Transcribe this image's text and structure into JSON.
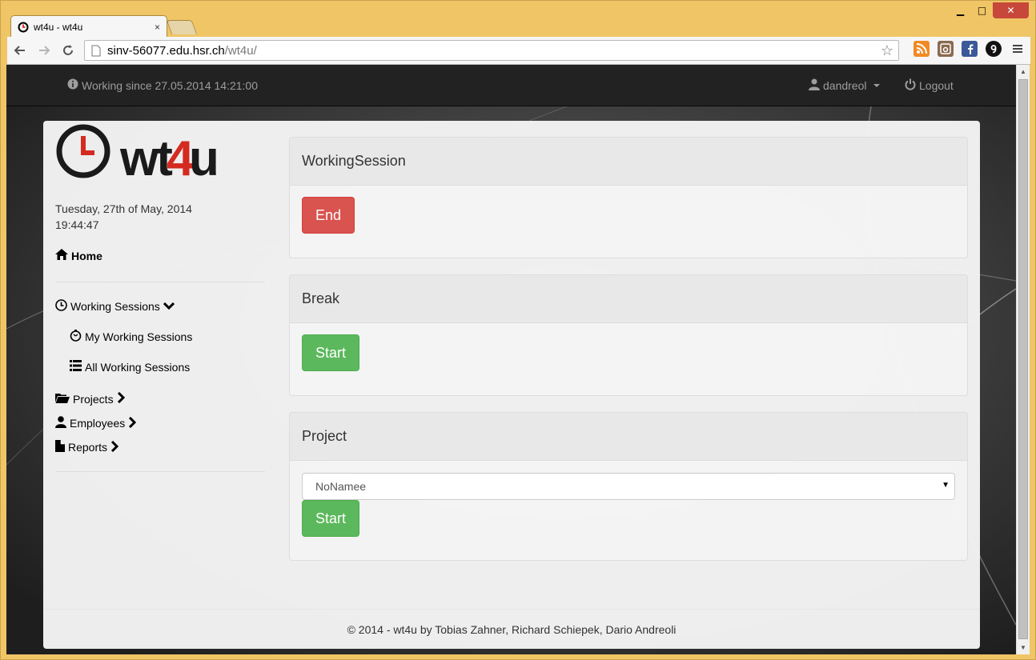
{
  "browser": {
    "tab_title": "wt4u - wt4u",
    "tab_close": "×",
    "url_host": "sinv-56077.edu.hsr.ch",
    "url_path": "/wt4u/",
    "window_controls": {
      "minimize": "▁",
      "maximize": "□",
      "close": "✕"
    }
  },
  "navbar": {
    "working_since": "Working since 27.05.2014 14:21:00",
    "user": "dandreol",
    "logout": "Logout"
  },
  "sidebar": {
    "logo_text": "wt4u",
    "date": "Tuesday, 27th of May, 2014",
    "time": "19:44:47",
    "home": "Home",
    "working_sessions": "Working Sessions",
    "my_working_sessions": "My Working Sessions",
    "all_working_sessions": "All Working Sessions",
    "projects": "Projects",
    "employees": "Employees",
    "reports": "Reports"
  },
  "panels": {
    "working_session": {
      "title": "WorkingSession",
      "button": "End"
    },
    "break": {
      "title": "Break",
      "button": "Start"
    },
    "project": {
      "title": "Project",
      "select_value": "NoNamee",
      "button": "Start"
    }
  },
  "footer": {
    "text": "© 2014 - wt4u by Tobias Zahner, Richard Schiepek, Dario Andreoli"
  },
  "colors": {
    "danger": "#d9534f",
    "success": "#5cb85c",
    "navbar": "#222222",
    "logo_red": "#d42a1f"
  }
}
